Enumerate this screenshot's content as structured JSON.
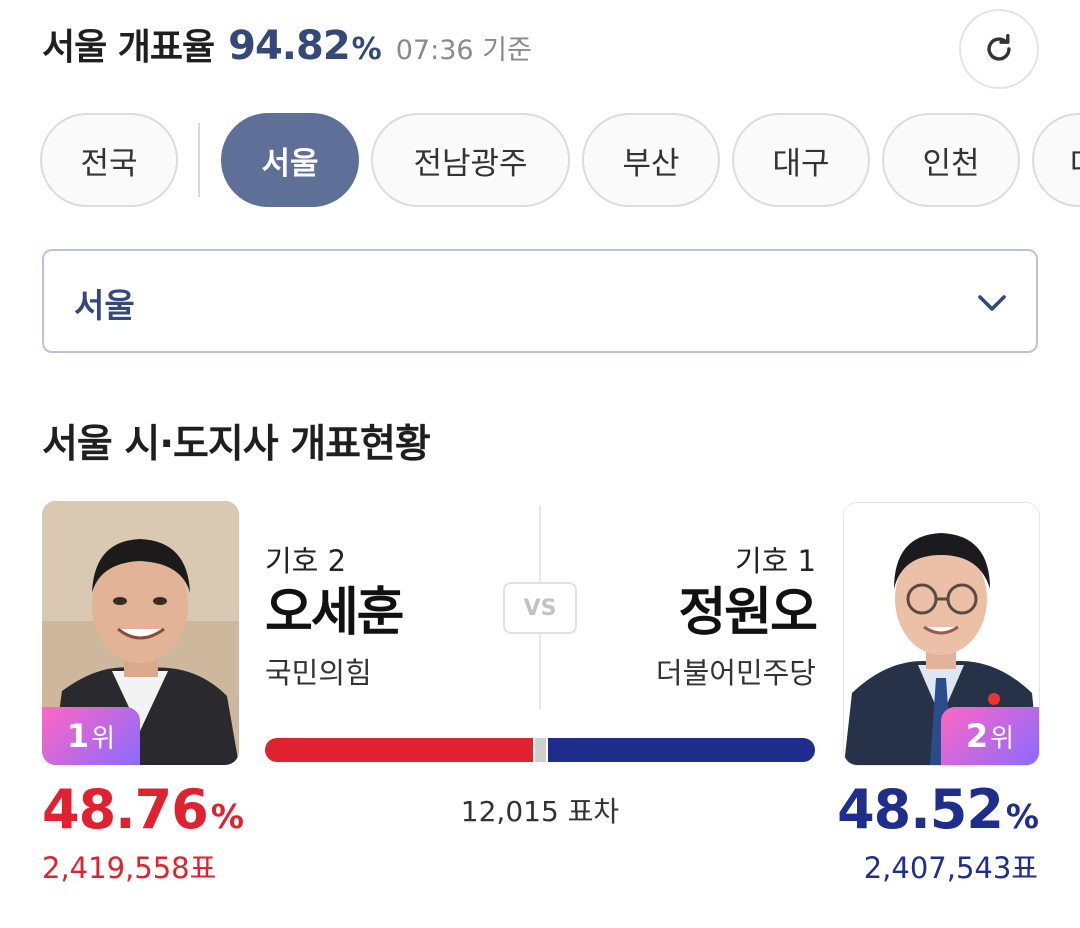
{
  "header": {
    "title": "서울 개표율",
    "count_rate": "94.82",
    "count_rate_unit": "%",
    "time": "07:36 기준",
    "refresh_icon": "refresh-icon"
  },
  "tabs": [
    {
      "label": "전국",
      "active": false
    },
    {
      "label": "서울",
      "active": true
    },
    {
      "label": "전남광주",
      "active": false
    },
    {
      "label": "부산",
      "active": false
    },
    {
      "label": "대구",
      "active": false
    },
    {
      "label": "인천",
      "active": false
    },
    {
      "label": "대",
      "active": false
    }
  ],
  "select": {
    "value": "서울",
    "icon": "chevron-down-icon"
  },
  "section_title": "서울 시·도지사 개표현황",
  "vs_label": "VS",
  "candidates": {
    "left": {
      "number": "기호 2",
      "name": "오세훈",
      "party": "국민의힘",
      "rank_num": "1",
      "rank_suffix": "위",
      "pct": "48.76",
      "pct_unit": "%",
      "votes": "2,419,558표",
      "color": "#e0212f",
      "share": 0.4876
    },
    "right": {
      "number": "기호 1",
      "name": "정원오",
      "party": "더불어민주당",
      "rank_num": "2",
      "rank_suffix": "위",
      "pct": "48.52",
      "pct_unit": "%",
      "votes": "2,407,543표",
      "color": "#1f2e8c",
      "share": 0.4852
    }
  },
  "vote_difference": "12,015 표차"
}
